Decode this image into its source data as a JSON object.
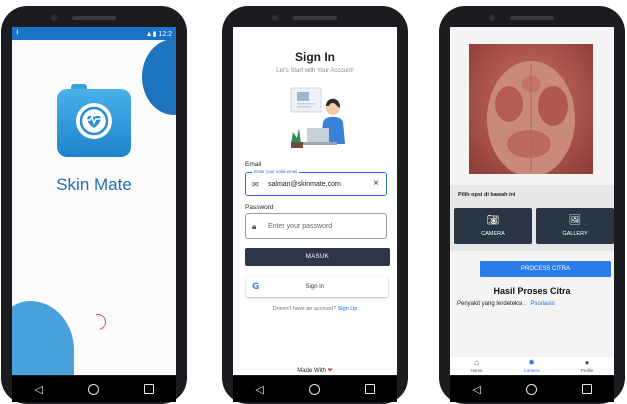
{
  "splash": {
    "status_time": "12:2",
    "app_name": "Skin Mate",
    "colors": {
      "primary": "#1e73bd",
      "accent": "#4ab0ea",
      "spinner": "#e8454f"
    }
  },
  "signin": {
    "title": "Sign In",
    "subtitle": "Let's Start with Your Account!",
    "email_label": "Email",
    "email_legend": "Enter your valid email",
    "email_value": "salman@skinmate.com",
    "password_label": "Password",
    "password_placeholder": "Enter your password",
    "submit_label": "MASUK",
    "google_label": "Sign in",
    "google_g": "G",
    "signup_prompt": "Doesn't have an account?",
    "signup_link": "Sign Up",
    "made_with": "Made With",
    "heart": "❤"
  },
  "result": {
    "opsi_title": "Pilih opsi di bawah ini",
    "camera_label": "CAMERA",
    "gallery_label": "GALLERY",
    "process_label": "PROCESS CITRA",
    "hasil_title": "Hasil Proses Citra",
    "penyakit_label": "Penyakit yang terdeteksi :",
    "penyakit_value": "Psoriasis",
    "nav": [
      {
        "label": "Home",
        "icon": "home-icon"
      },
      {
        "label": "Camera",
        "icon": "camera-aperture-icon"
      },
      {
        "label": "Profile",
        "icon": "person-icon"
      }
    ]
  },
  "system_nav": {
    "back": "◁",
    "home": "○",
    "recent": "□"
  }
}
